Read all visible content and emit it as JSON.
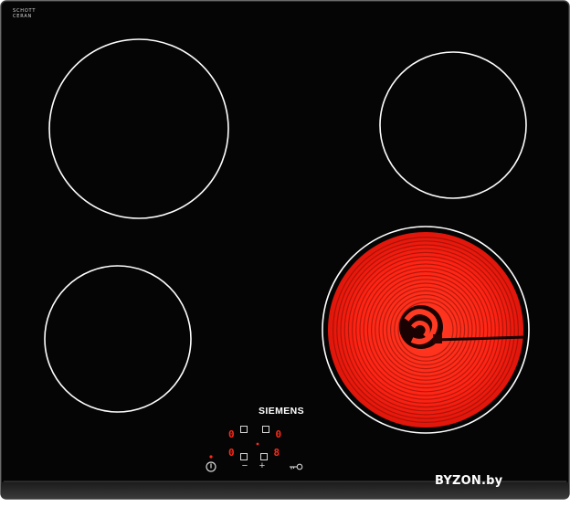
{
  "hob": {
    "glass_brand": [
      "SCHOTT",
      "CERAN"
    ],
    "manufacturer": "SIEMENS",
    "controls": {
      "power_icon": "power-icon",
      "minus": "−",
      "plus": "+",
      "lock_icon": "key-icon"
    },
    "displays": [
      "0",
      "0",
      "0",
      "8"
    ],
    "active_zone": "front-right"
  },
  "watermark": {
    "text": "BYZON.by"
  },
  "colors": {
    "glass": "#050505",
    "ring": "#ffffff",
    "heat": "#ff2a1a",
    "frame": "#2a2a2a"
  }
}
